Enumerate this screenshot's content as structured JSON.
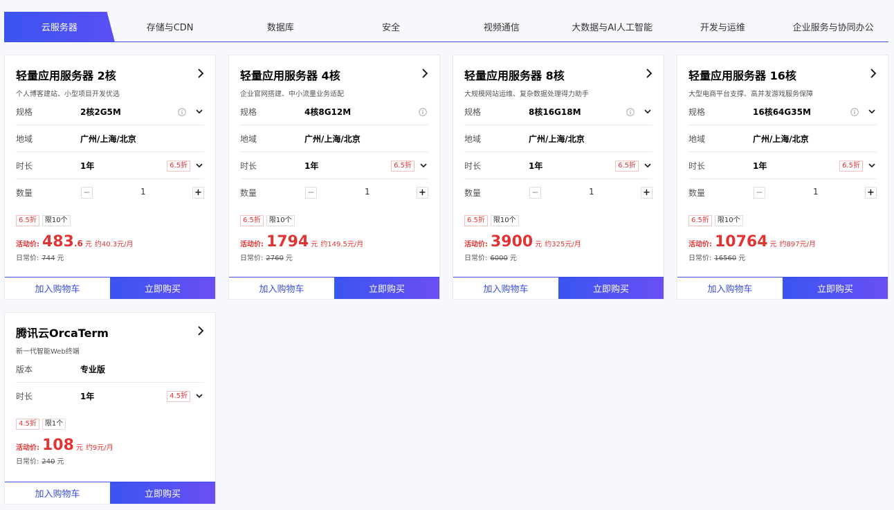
{
  "tabs": [
    "云服务器",
    "存储与CDN",
    "数据库",
    "安全",
    "视频通信",
    "大数据与AI人工智能",
    "开发与运维",
    "企业服务与协同办公"
  ],
  "labels": {
    "spec": "规格",
    "region": "地域",
    "duration": "时长",
    "quantity": "数量",
    "edition": "版本",
    "activity_price": "活动价:",
    "daily_price": "日常价:",
    "yuan": "元",
    "add_to_cart": "加入购物车",
    "buy_now": "立即购买"
  },
  "cards": [
    {
      "title": "轻量应用服务器 2核",
      "subtitle": "个人博客建站、小型项目开发优选",
      "spec": "2核2G5M",
      "region": "广州/上海/北京",
      "duration": "1年",
      "discount": "6.5折",
      "quantity": "1",
      "tag_discount": "6.5折",
      "tag_limit": "限10个",
      "price_int": "483",
      "price_dec": ".6",
      "per_month": "约40.3元/月",
      "original": "744"
    },
    {
      "title": "轻量应用服务器 4核",
      "subtitle": "企业官网搭建、中小流量业务适配",
      "spec": "4核8G12M",
      "region": "广州/上海/北京",
      "duration": "1年",
      "discount": "6.5折",
      "quantity": "1",
      "tag_discount": "6.5折",
      "tag_limit": "限10个",
      "price_int": "1794",
      "price_dec": "",
      "per_month": "约149.5元/月",
      "original": "2760"
    },
    {
      "title": "轻量应用服务器 8核",
      "subtitle": "大规模网站运维、复杂数据处理得力助手",
      "spec": "8核16G18M",
      "region": "广州/上海/北京",
      "duration": "1年",
      "discount": "6.5折",
      "quantity": "1",
      "tag_discount": "6.5折",
      "tag_limit": "限10个",
      "price_int": "3900",
      "price_dec": "",
      "per_month": "约325元/月",
      "original": "6000"
    },
    {
      "title": "轻量应用服务器 16核",
      "subtitle": "大型电商平台支撑、高并发游戏服务保障",
      "spec": "16核64G35M",
      "region": "广州/上海/北京",
      "duration": "1年",
      "discount": "6.5折",
      "quantity": "1",
      "tag_discount": "6.5折",
      "tag_limit": "限10个",
      "price_int": "10764",
      "price_dec": "",
      "per_month": "约897元/月",
      "original": "16560"
    },
    {
      "title": "腾讯云OrcaTerm",
      "subtitle": "新一代智能Web终端",
      "edition": "专业版",
      "duration": "1年",
      "discount": "4.5折",
      "tag_discount": "4.5折",
      "tag_limit": "限1个",
      "price_int": "108",
      "price_dec": "",
      "per_month": "约9元/月",
      "original": "240"
    }
  ],
  "colors": {
    "accent": "#3b4ee0",
    "price_red": "#e03535"
  }
}
